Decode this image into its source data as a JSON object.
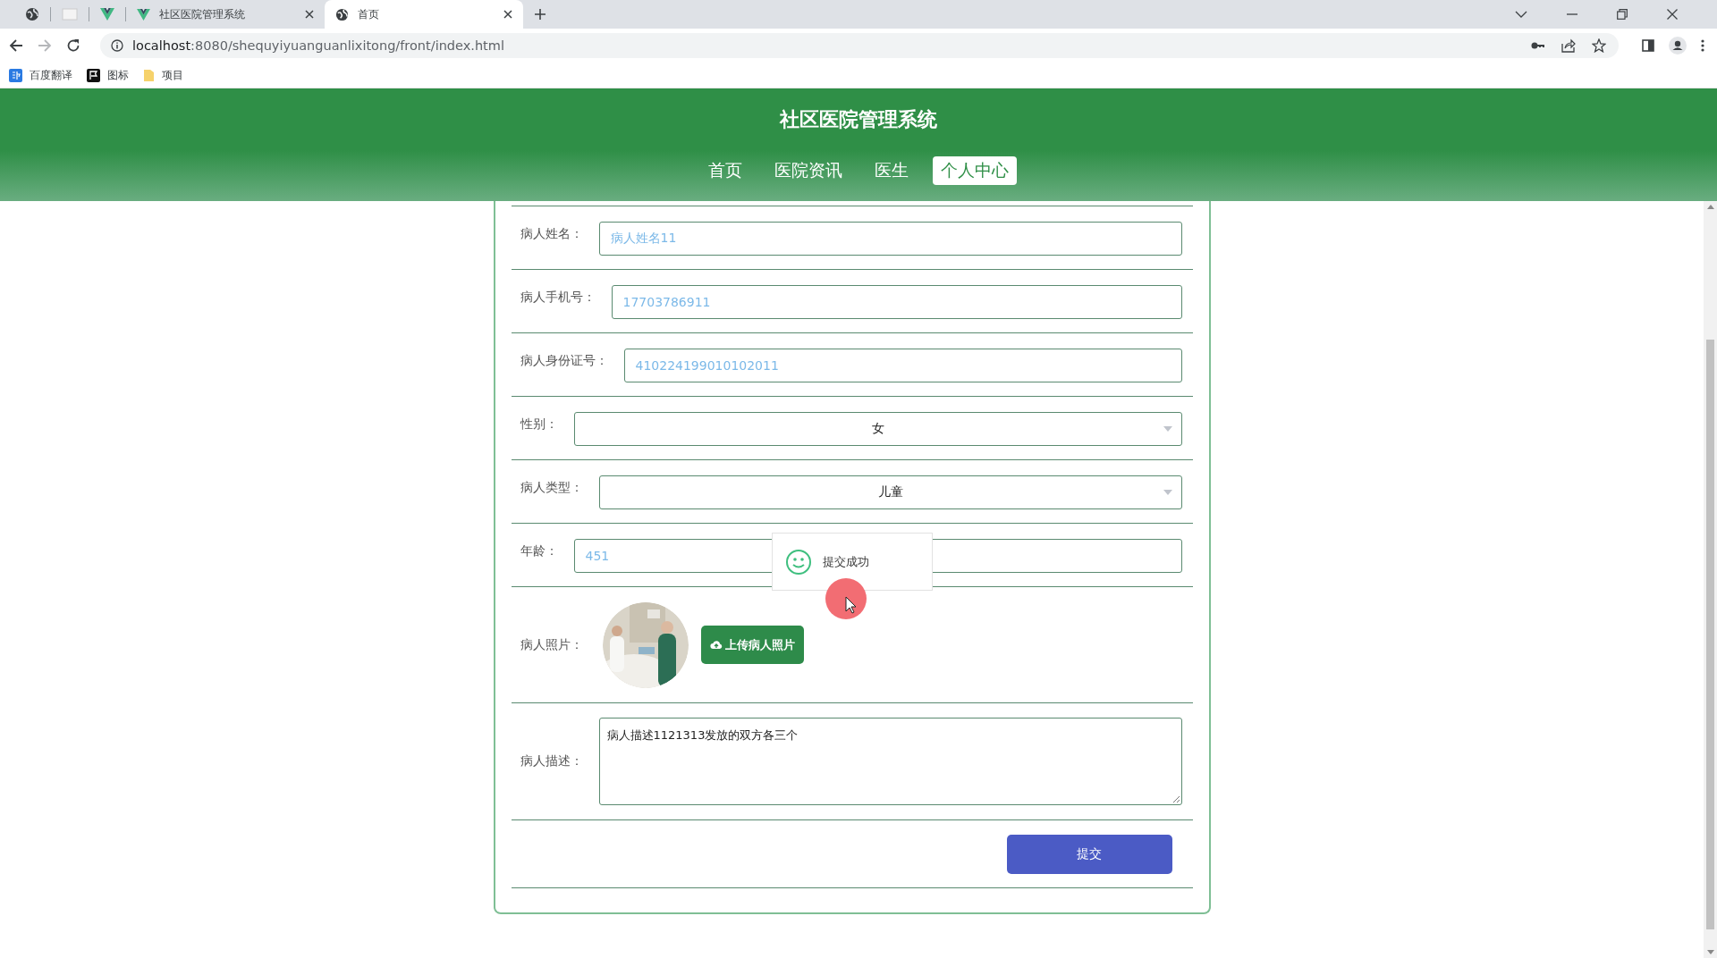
{
  "browser": {
    "tabs": [
      {
        "title": "社区医院管理系统",
        "kind": "vue",
        "selected": false
      },
      {
        "title": "首页",
        "kind": "globe",
        "selected": true
      }
    ],
    "address": {
      "host": "localhost",
      "rest": ":8080/shequyiyuanguanlixitong/front/index.html"
    },
    "bookmarks": [
      {
        "label": "百度翻译",
        "kind": "translate"
      },
      {
        "label": "图标",
        "kind": "flag"
      },
      {
        "label": "项目",
        "kind": "folder"
      }
    ]
  },
  "site": {
    "title": "社区医院管理系统",
    "nav": [
      {
        "label": "首页",
        "selected": false
      },
      {
        "label": "医院资讯",
        "selected": false
      },
      {
        "label": "医生",
        "selected": false
      },
      {
        "label": "个人中心",
        "selected": true
      }
    ]
  },
  "form": {
    "rows": [
      {
        "kind": "input",
        "label": "病人姓名：",
        "value": "病人姓名11"
      },
      {
        "kind": "input",
        "label": "病人手机号：",
        "value": "17703786911"
      },
      {
        "kind": "input",
        "label": "病人身份证号：",
        "value": "410224199010102011"
      },
      {
        "kind": "select",
        "label": "性别：",
        "value": "女"
      },
      {
        "kind": "select",
        "label": "病人类型：",
        "value": "儿童"
      },
      {
        "kind": "input",
        "label": "年龄：",
        "value": "451"
      },
      {
        "label": "病人照片：",
        "button": "上传病人照片"
      },
      {
        "kind": "textarea",
        "label": "病人描述：",
        "value": "病人描述1121313发放的双方各三个"
      }
    ],
    "submit": "提交"
  },
  "toast": {
    "message": "提交成功"
  }
}
